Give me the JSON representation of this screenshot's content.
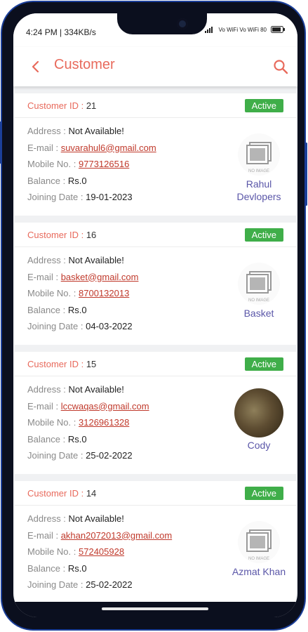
{
  "status": {
    "time_speed": "4:24 PM | 334KB/s",
    "right_indicators": "Vo WiFi  Vo WiFi  80"
  },
  "appbar": {
    "title": "Customer"
  },
  "labels": {
    "customer_id": "Customer ID :",
    "address": "Address :",
    "email": "E-mail :",
    "mobile": "Mobile No. :",
    "balance": "Balance :",
    "joining": "Joining Date :",
    "no_image": "NO IMAGE"
  },
  "customers": [
    {
      "id": "21",
      "status": "Active",
      "address": "Not Available!",
      "email": "suvarahul6@gmail.com",
      "mobile": "9773126516",
      "balance": "Rs.0",
      "joining": "19-01-2023",
      "name": "Rahul Devlopers",
      "has_photo": false
    },
    {
      "id": "16",
      "status": "Active",
      "address": "Not Available!",
      "email": "basket@gmail.com",
      "mobile": "8700132013",
      "balance": "Rs.0",
      "joining": "04-03-2022",
      "name": "Basket",
      "has_photo": false
    },
    {
      "id": "15",
      "status": "Active",
      "address": "Not Available!",
      "email": "lccwaqas@gmail.com",
      "mobile": "3126961328",
      "balance": "Rs.0",
      "joining": "25-02-2022",
      "name": "Cody",
      "has_photo": true
    },
    {
      "id": "14",
      "status": "Active",
      "address": "Not Available!",
      "email": "akhan2072013@gmail.com",
      "mobile": "572405928",
      "balance": "Rs.0",
      "joining": "25-02-2022",
      "name": "Azmat Khan",
      "has_photo": false
    }
  ],
  "colors": {
    "accent": "#e86a5c",
    "active_badge": "#3fae49",
    "link": "#c0392b",
    "name": "#5a56a8"
  },
  "icons": [
    "back-arrow-icon",
    "search-icon",
    "no-image-icon"
  ]
}
